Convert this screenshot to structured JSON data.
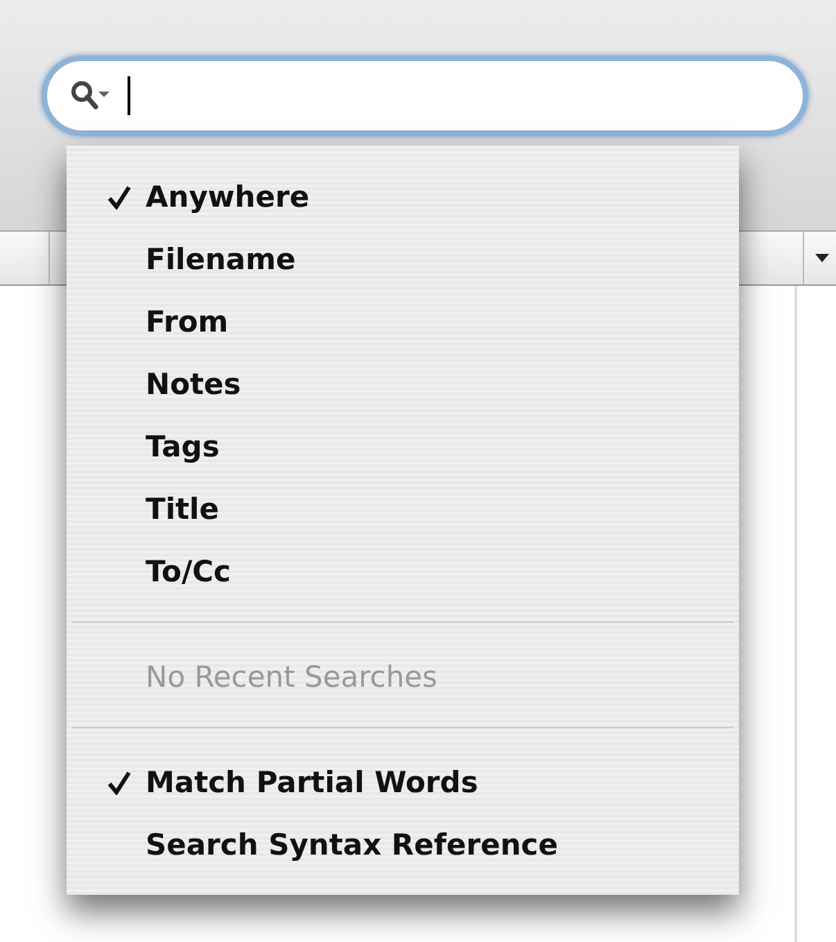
{
  "toolbar": {
    "search_field": {
      "focused": true
    }
  },
  "menu": {
    "sections": [
      [
        {
          "label": "Anywhere",
          "checked": true,
          "disabled": false
        },
        {
          "label": "Filename",
          "checked": false,
          "disabled": false
        },
        {
          "label": "From",
          "checked": false,
          "disabled": false
        },
        {
          "label": "Notes",
          "checked": false,
          "disabled": false
        },
        {
          "label": "Tags",
          "checked": false,
          "disabled": false
        },
        {
          "label": "Title",
          "checked": false,
          "disabled": false
        },
        {
          "label": "To/Cc",
          "checked": false,
          "disabled": false
        }
      ],
      [
        {
          "label": "No Recent Searches",
          "checked": false,
          "disabled": true
        }
      ],
      [
        {
          "label": "Match Partial Words",
          "checked": true,
          "disabled": false
        },
        {
          "label": "Search Syntax Reference",
          "checked": false,
          "disabled": false
        }
      ]
    ]
  }
}
